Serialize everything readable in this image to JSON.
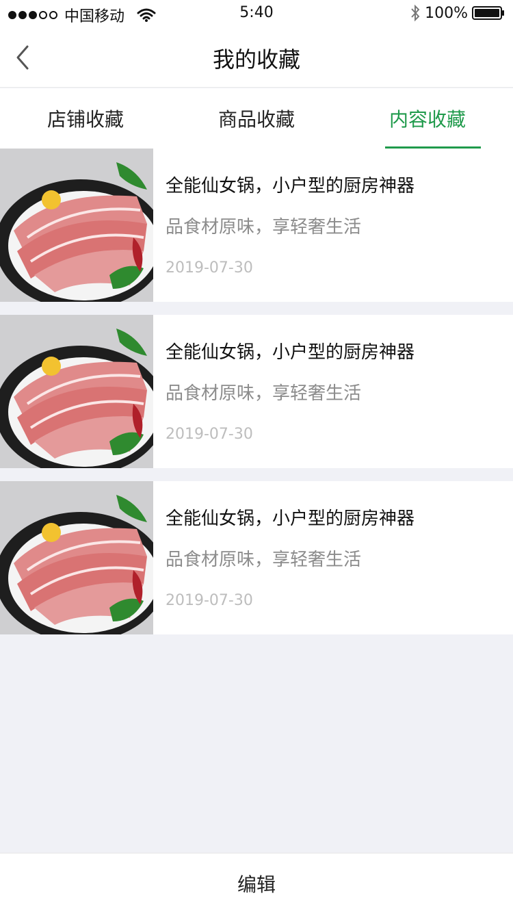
{
  "status_bar": {
    "carrier": "中国移动",
    "time": "5:40",
    "battery": "100%",
    "signal_strength": 3,
    "signal_max": 5
  },
  "nav": {
    "title": "我的收藏",
    "back_icon": "chevron-left-icon"
  },
  "tabs": [
    {
      "label": "店铺收藏",
      "active": false
    },
    {
      "label": "商品收藏",
      "active": false
    },
    {
      "label": "内容收藏",
      "active": true
    }
  ],
  "items": [
    {
      "title": "全能仙女锅，小户型的厨房神器",
      "subtitle": "品食材原味，享轻奢生活",
      "date": "2019-07-30"
    },
    {
      "title": "全能仙女锅，小户型的厨房神器",
      "subtitle": "品食材原味，享轻奢生活",
      "date": "2019-07-30"
    },
    {
      "title": "全能仙女锅，小户型的厨房神器",
      "subtitle": "品食材原味，享轻奢生活",
      "date": "2019-07-30"
    }
  ],
  "bottom": {
    "edit_label": "编辑"
  },
  "colors": {
    "accent": "#1f9a4b",
    "background": "#f0f1f6",
    "title_text": "#111111",
    "subtitle_text": "#8c8c8c",
    "date_text": "#bdbdbd"
  }
}
